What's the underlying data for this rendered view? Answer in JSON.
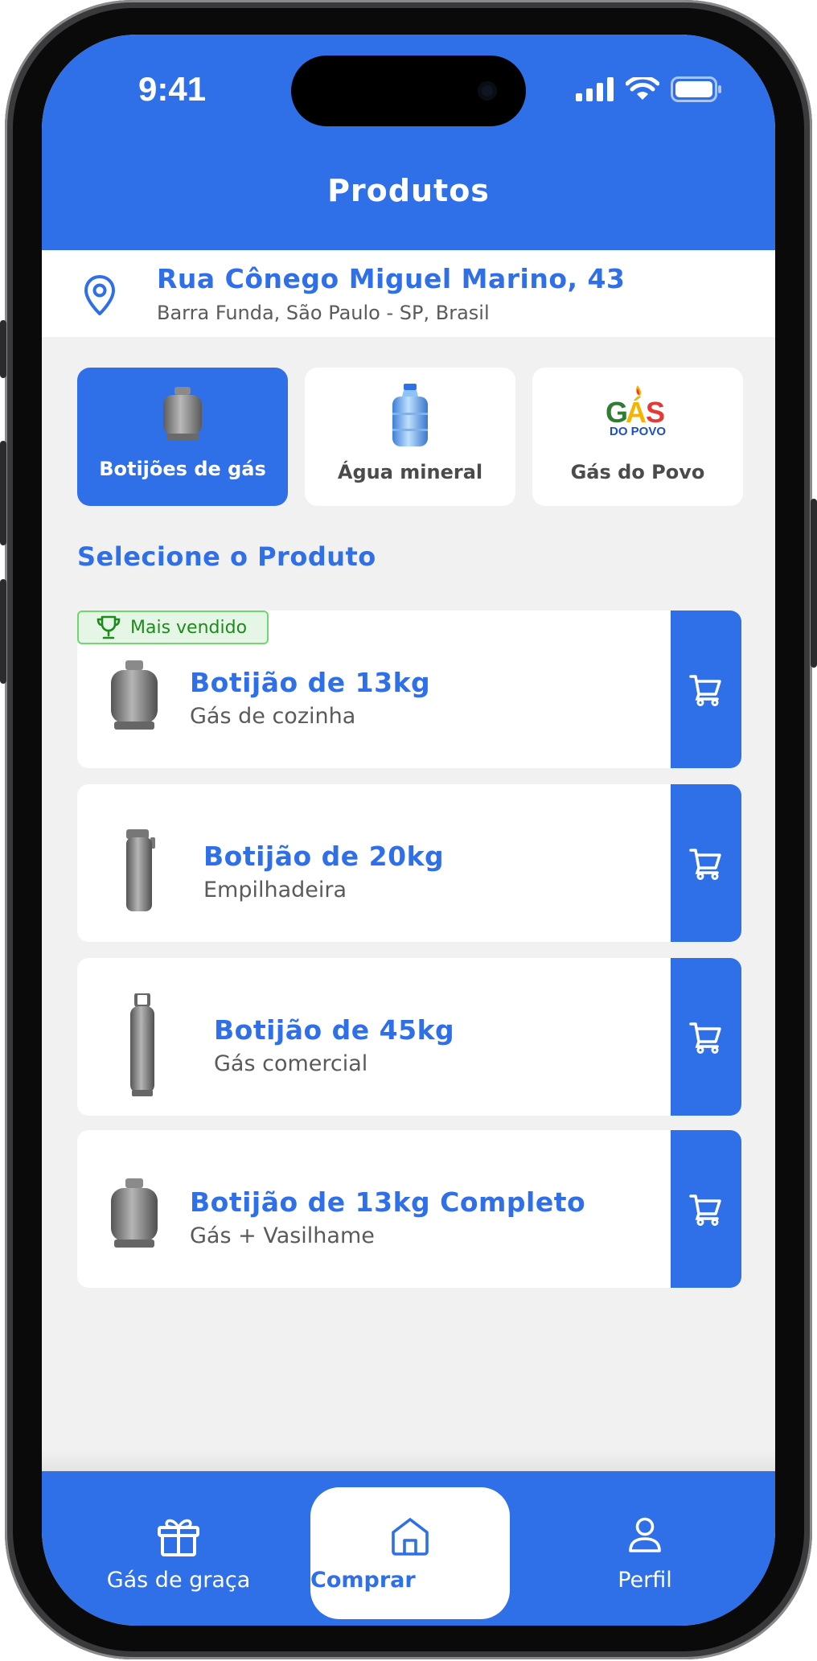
{
  "status_bar": {
    "time": "9:41"
  },
  "header": {
    "title": "Produtos"
  },
  "address": {
    "street": "Rua Cônego Miguel Marino, 43",
    "region": "Barra Funda, São Paulo - SP, Brasil"
  },
  "categories": [
    {
      "label": "Botijões de gás",
      "active": true
    },
    {
      "label": "Água mineral",
      "active": false
    },
    {
      "label": "Gás do Povo",
      "active": false,
      "logo": {
        "line1": "GÁS",
        "line2": "DO POVO"
      }
    }
  ],
  "section": {
    "title": "Selecione o Produto"
  },
  "badge": {
    "label": "Mais vendido"
  },
  "products": [
    {
      "name": "Botijão de 13kg",
      "desc": "Gás de cozinha"
    },
    {
      "name": "Botijão de 20kg",
      "desc": "Empilhadeira"
    },
    {
      "name": "Botijão de 45kg",
      "desc": "Gás comercial"
    },
    {
      "name": "Botijão de 13kg Completo",
      "desc": "Gás + Vasilhame"
    }
  ],
  "bottom_nav": [
    {
      "label": "Gás de graça",
      "icon": "gift-icon"
    },
    {
      "label": "Comprar",
      "icon": "home-icon",
      "active": true
    },
    {
      "label": "Perfil",
      "icon": "user-icon"
    }
  ],
  "colors": {
    "primary": "#2f6fe8",
    "background": "#f1f1f1",
    "badge_bg": "#e6f6e6",
    "badge_border": "#6ed86e"
  }
}
